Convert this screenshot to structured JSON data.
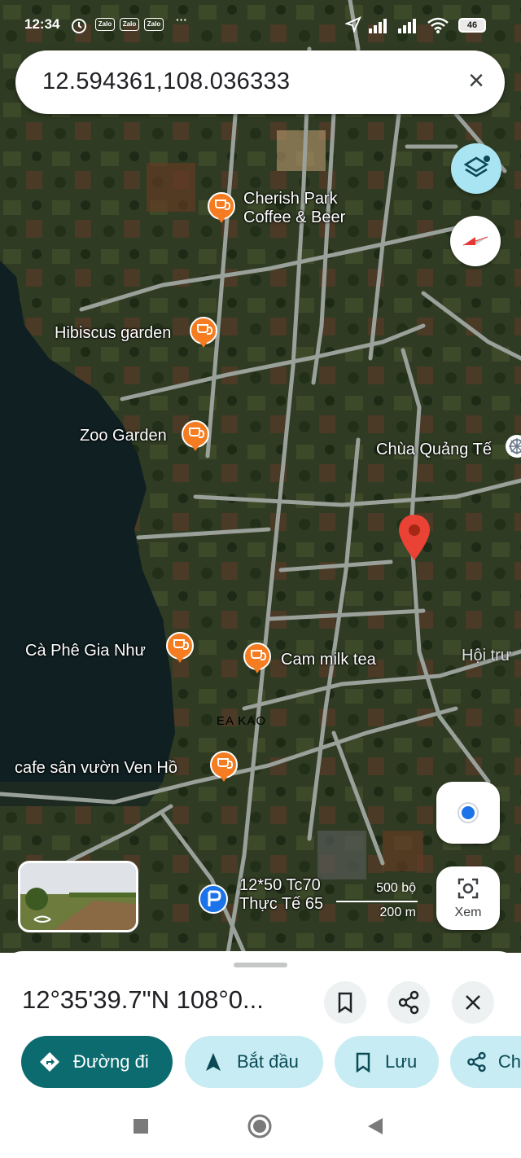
{
  "status_bar": {
    "time": "12:34",
    "apps": [
      "Zalo",
      "Zalo",
      "Zalo"
    ],
    "more": "···",
    "battery": "46"
  },
  "search": {
    "value": "12.594361,108.036333",
    "clear_icon": "close-icon"
  },
  "map": {
    "pois": [
      {
        "name_line1": "Cherish Park",
        "name_line2": "Coffee & Beer",
        "icon": "cafe-icon"
      },
      {
        "name": "Hibiscus garden",
        "icon": "cafe-icon"
      },
      {
        "name": "Zoo Garden",
        "icon": "cafe-icon"
      },
      {
        "name": "Cà Phê Gia Như",
        "icon": "cafe-icon"
      },
      {
        "name": "Cam milk tea",
        "icon": "cafe-icon"
      },
      {
        "name": "cafe sân vườn Ven Hồ",
        "icon": "cafe-icon"
      },
      {
        "name": "Chùa Quảng Tế",
        "icon": "temple-icon"
      }
    ],
    "area_label": "EA KAO",
    "partial_label": "Hội trư",
    "business": {
      "line1": "12*50 Tc70",
      "line2": "Thực Tế 65",
      "icon": "parking-icon"
    },
    "scale": {
      "imperial": "500 bộ",
      "metric": "200 m"
    },
    "view_button_label": "Xem",
    "colors": {
      "pin": "#ea4335",
      "poi": "#f57c20",
      "location": "#1a73e8"
    }
  },
  "sheet": {
    "coordinates": "12°35'39.7\"N 108°0...",
    "actions": [
      {
        "label": "Đường đi",
        "icon": "directions-icon"
      },
      {
        "label": "Bắt đầu",
        "icon": "navigation-icon"
      },
      {
        "label": "Lưu",
        "icon": "bookmark-icon"
      },
      {
        "label": "Ch",
        "icon": "share-icon"
      }
    ]
  },
  "colors": {
    "primary": "#0b6b6f",
    "chip": "#c7ecf4"
  }
}
